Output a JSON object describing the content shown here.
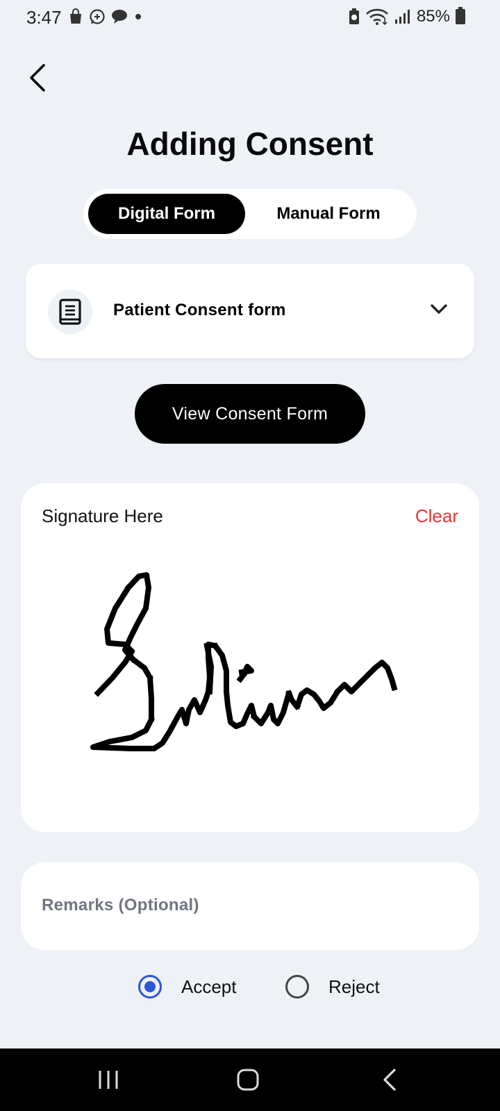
{
  "status_bar": {
    "time": "3:47",
    "battery": "85%"
  },
  "header": {
    "title": "Adding Consent"
  },
  "tabs": [
    {
      "label": "Digital Form",
      "active": true
    },
    {
      "label": "Manual Form",
      "active": false
    }
  ],
  "form_select": {
    "selected": "Patient Consent form"
  },
  "view_button": "View Consent Form",
  "signature": {
    "label": "Signature Here",
    "clear_label": "Clear"
  },
  "remarks": {
    "placeholder": "Remarks (Optional)",
    "value": ""
  },
  "decision": {
    "options": [
      {
        "label": "Accept",
        "selected": true
      },
      {
        "label": "Reject",
        "selected": false
      }
    ]
  },
  "colors": {
    "accent": "#2a56d8",
    "danger": "#e53935",
    "background": "#eef1f6"
  }
}
